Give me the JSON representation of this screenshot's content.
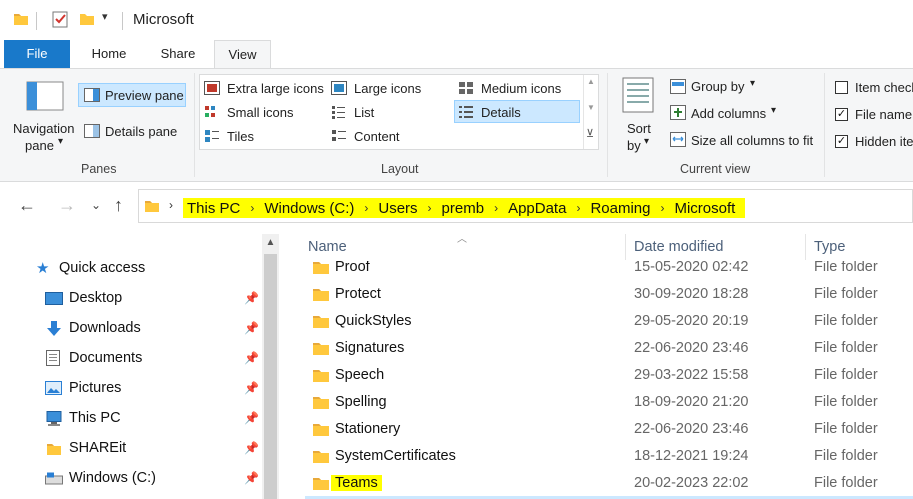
{
  "window": {
    "title": "Microsoft"
  },
  "tabs": [
    {
      "label": "File"
    },
    {
      "label": "Home"
    },
    {
      "label": "Share"
    },
    {
      "label": "View"
    }
  ],
  "ribbon": {
    "panes": {
      "navigation_pane_line1": "Navigation",
      "navigation_pane_line2": "pane",
      "preview_pane": "Preview pane",
      "details_pane": "Details pane",
      "group_label": "Panes"
    },
    "layout": {
      "extra_large_icons": "Extra large icons",
      "large_icons": "Large icons",
      "medium_icons": "Medium icons",
      "small_icons": "Small icons",
      "list": "List",
      "details": "Details",
      "tiles": "Tiles",
      "content": "Content",
      "group_label": "Layout"
    },
    "current_view": {
      "sort_line1": "Sort",
      "sort_line2": "by",
      "group_by": "Group by",
      "add_columns": "Add columns",
      "size_all_columns": "Size all columns to fit",
      "group_label": "Current view"
    },
    "show_hide": {
      "item_check_boxes": "Item check",
      "file_name_extensions": "File name",
      "hidden_items": "Hidden ite",
      "item_check_checked": false,
      "file_name_checked": true,
      "hidden_checked": true
    }
  },
  "address": {
    "crumbs": [
      "This PC",
      "Windows (C:)",
      "Users",
      "premb",
      "AppData",
      "Roaming",
      "Microsoft"
    ],
    "highlight_color": "#ffff00"
  },
  "nav": {
    "items": [
      {
        "label": "Quick access",
        "icon": "star-icon",
        "pinned": false
      },
      {
        "label": "Desktop",
        "icon": "desktop-icon",
        "pinned": true
      },
      {
        "label": "Downloads",
        "icon": "download-arrow-icon",
        "pinned": true
      },
      {
        "label": "Documents",
        "icon": "documents-icon",
        "pinned": true
      },
      {
        "label": "Pictures",
        "icon": "pictures-icon",
        "pinned": true
      },
      {
        "label": "This PC",
        "icon": "computer-icon",
        "pinned": true
      },
      {
        "label": "SHAREit",
        "icon": "folder-icon",
        "pinned": true
      },
      {
        "label": "Windows (C:)",
        "icon": "drive-icon",
        "pinned": true
      }
    ]
  },
  "files": {
    "columns": {
      "name": "Name",
      "date_modified": "Date modified",
      "type": "Type"
    },
    "rows": [
      {
        "name": "Proof",
        "date": "15-05-2020 02:42",
        "type": "File folder"
      },
      {
        "name": "Protect",
        "date": "30-09-2020 18:28",
        "type": "File folder"
      },
      {
        "name": "QuickStyles",
        "date": "29-05-2020 20:19",
        "type": "File folder"
      },
      {
        "name": "Signatures",
        "date": "22-06-2020 23:46",
        "type": "File folder"
      },
      {
        "name": "Speech",
        "date": "29-03-2022 15:58",
        "type": "File folder"
      },
      {
        "name": "Spelling",
        "date": "18-09-2020 21:20",
        "type": "File folder"
      },
      {
        "name": "Stationery",
        "date": "22-06-2020 23:46",
        "type": "File folder"
      },
      {
        "name": "SystemCertificates",
        "date": "18-12-2021 19:24",
        "type": "File folder"
      },
      {
        "name": "Teams",
        "date": "20-02-2023 22:02",
        "type": "File folder"
      }
    ]
  },
  "colors": {
    "accent": "#1979ca",
    "folder": "#ffc83d",
    "selection": "#cce8ff"
  }
}
